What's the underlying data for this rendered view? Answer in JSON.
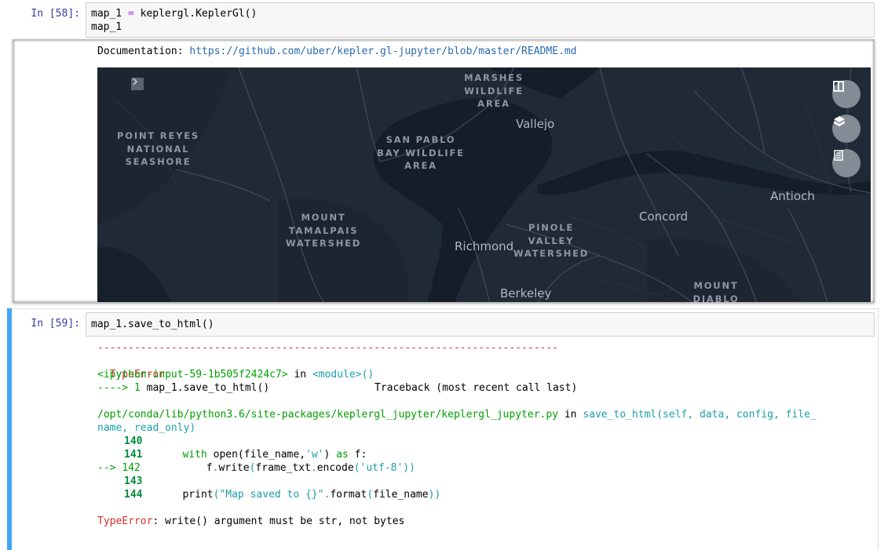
{
  "cell1": {
    "prompt": "In [58]:",
    "code_line1": {
      "var": "map_1",
      "eq": "=",
      "rhs": "keplergl.KeplerGl()"
    },
    "code_line2": "map_1"
  },
  "output": {
    "doc_label": "Documentation:",
    "doc_link": "https://github.com/uber/kepler.gl-jupyter/blob/master/README.md",
    "map": {
      "places": {
        "marshes": [
          "MARSHES",
          "WILDLIFE",
          "AREA"
        ],
        "point_reyes": [
          "POINT REYES",
          "NATIONAL",
          "SEASHORE"
        ],
        "san_pablo": [
          "SAN PABLO",
          "BAY WILDLIFE",
          "AREA"
        ],
        "tamalpais": [
          "MOUNT",
          "TAMALPAIS",
          "WATERSHED"
        ],
        "pinole": [
          "PINOLE",
          "VALLEY",
          "WATERSHED"
        ],
        "diablo": [
          "MOUNT",
          "DIABLO"
        ]
      },
      "cities": {
        "vallejo": "Vallejo",
        "antioch": "Antioch",
        "concord": "Concord",
        "richmond": "Richmond",
        "berkeley": "Berkeley"
      },
      "colors": {
        "background": "#202a36",
        "water": "#131c27",
        "roads": "#3d4958",
        "label": "#8c97a3"
      }
    }
  },
  "cell2": {
    "prompt": "In [59]:",
    "code": "map_1.save_to_html()",
    "traceback": {
      "dashes": "---------------------------------------------------------------------------",
      "error_type": "TypeError",
      "header_right": "Traceback (most recent call last)",
      "input_ref": "<ipython-input-59-1b505f2424c7>",
      "in_word": "in",
      "module": "<module>()",
      "arrow1": "----> 1",
      "arrow1_code": "map_1.save_to_html()",
      "file_path": "/opt/conda/lib/python3.6/site-packages/keplergl_jupyter/keplergl_jupyter.py",
      "func_sig_a": "save_to_html(self, data, config, file_",
      "func_sig_b": "name, read_only)",
      "lines": [
        {
          "num": "140",
          "code": ""
        },
        {
          "num": "141",
          "code": "with open(file_name,'w') as f:"
        },
        {
          "num": "142",
          "arrow": "-->",
          "code": "f.write(frame_txt.encode('utf-8'))"
        },
        {
          "num": "143",
          "code": ""
        },
        {
          "num": "144",
          "code": "print(\"Map saved to {}\".format(file_name))"
        }
      ],
      "final_type": "TypeError",
      "final_msg": ": write() argument must be str, not bytes"
    }
  }
}
